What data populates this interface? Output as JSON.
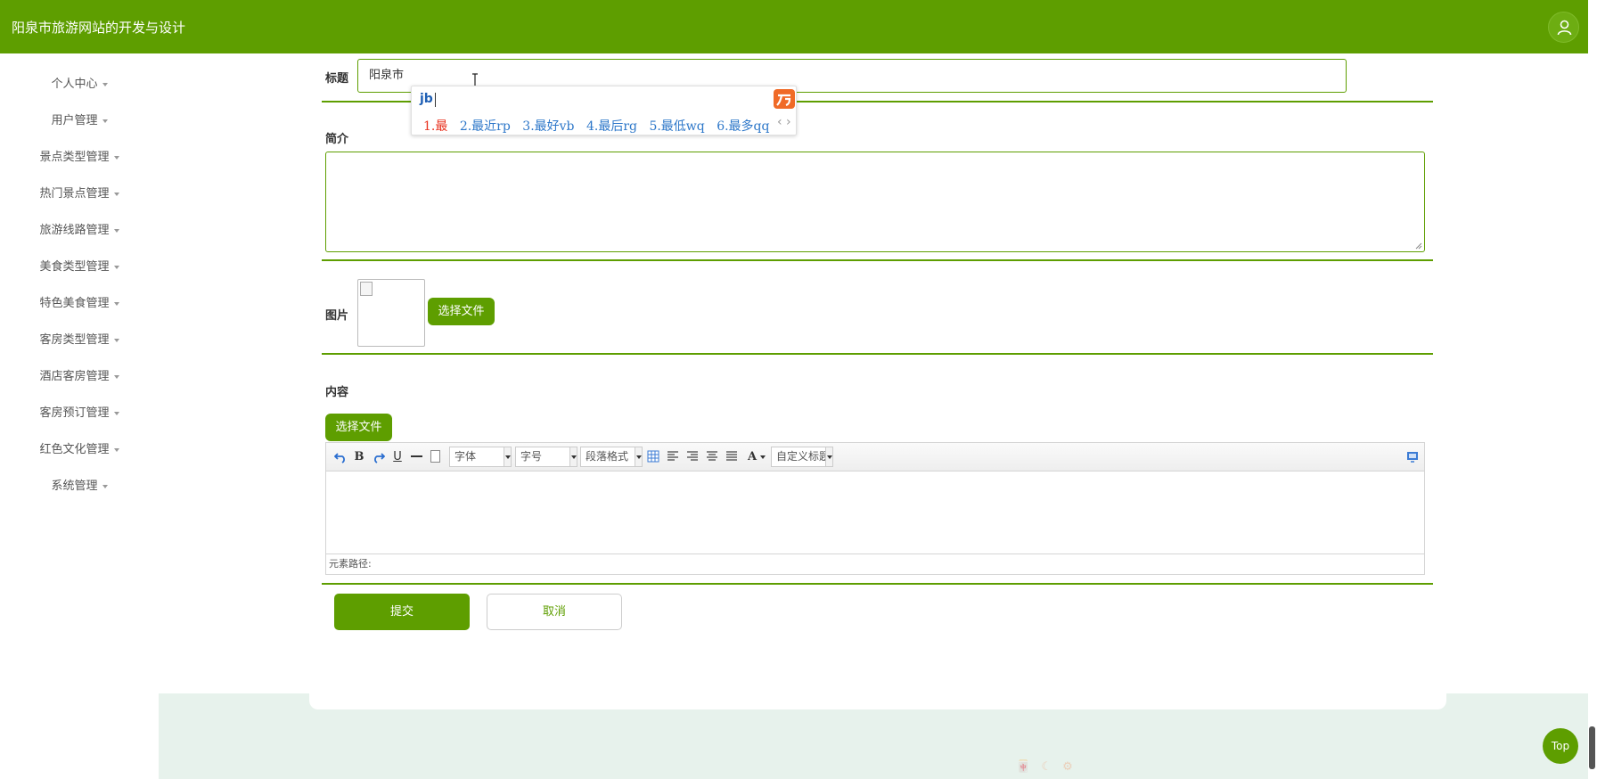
{
  "app": {
    "title": "阳泉市旅游网站的开发与设计"
  },
  "header": {
    "user_icon": "user-icon"
  },
  "sidebar": {
    "items": [
      {
        "label": "个人中心"
      },
      {
        "label": "用户管理"
      },
      {
        "label": "景点类型管理"
      },
      {
        "label": "热门景点管理"
      },
      {
        "label": "旅游线路管理"
      },
      {
        "label": "美食类型管理"
      },
      {
        "label": "特色美食管理"
      },
      {
        "label": "客房类型管理"
      },
      {
        "label": "酒店客房管理"
      },
      {
        "label": "客房预订管理"
      },
      {
        "label": "红色文化管理"
      },
      {
        "label": "系统管理"
      }
    ]
  },
  "form": {
    "title_label": "标题",
    "title_value": "阳泉市",
    "intro_label": "简介",
    "image_label": "图片",
    "choose_file": "选择文件",
    "content_label": "内容",
    "content_choose_file": "选择文件",
    "submit": "提交",
    "cancel": "取消"
  },
  "editor": {
    "font_family": "字体",
    "font_size": "字号",
    "paragraph": "段落格式",
    "custom_title": "自定义标题",
    "status_path": "元素路径:"
  },
  "ime": {
    "pinyin": "jb",
    "candidates": [
      "1.最",
      "2.最近rp",
      "3.最好vb",
      "4.最后rg",
      "5.最低wq",
      "6.最多qq"
    ],
    "nav": "‹ ›"
  },
  "top_button": "Top",
  "colors": {
    "primary": "#5e9e00",
    "footer_bg": "#e7f2ec",
    "ime_accent": "#f06a27"
  }
}
